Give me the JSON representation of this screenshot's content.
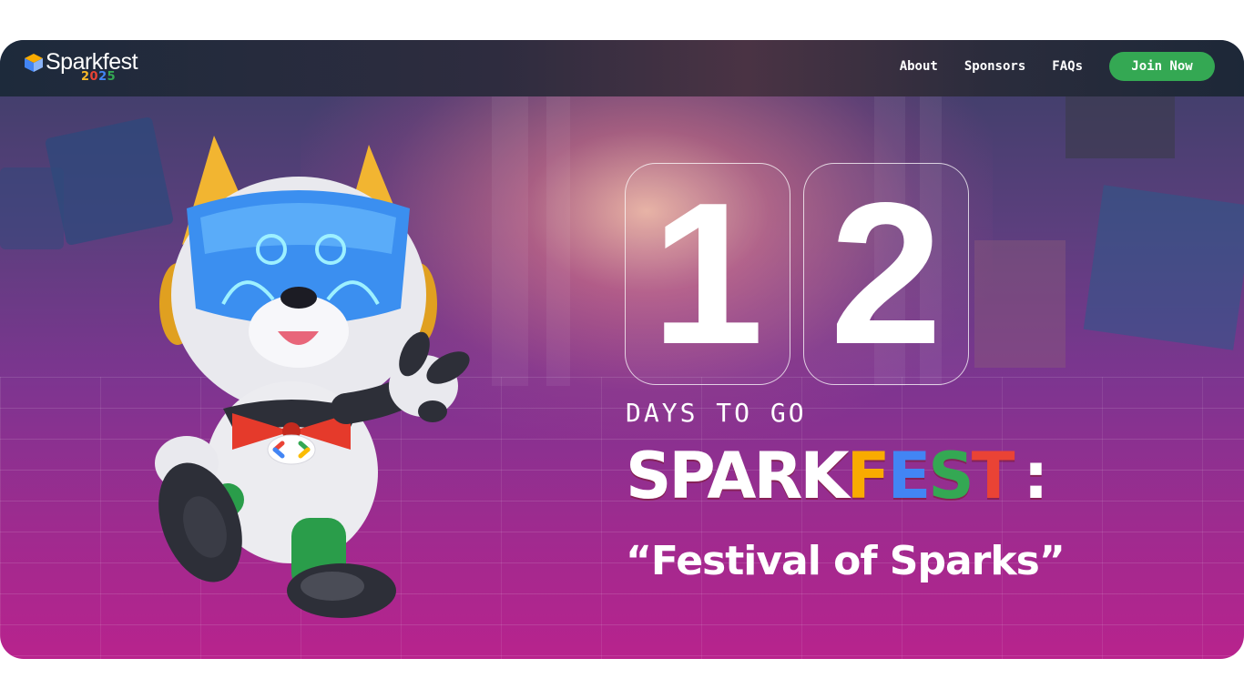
{
  "brand": {
    "name": "Sparkfest",
    "year_digits": [
      "2",
      "0",
      "2",
      "5"
    ]
  },
  "nav": {
    "links": [
      "About",
      "Sponsors",
      "FAQs"
    ],
    "cta_label": "Join Now"
  },
  "countdown": {
    "digits": [
      "1",
      "2"
    ],
    "caption": "DAYS TO GO"
  },
  "headline": {
    "part_white": "SPARK",
    "part_colored": [
      "F",
      "E",
      "S",
      "T"
    ],
    "suffix": ":"
  },
  "tagline": "“Festival of Sparks”",
  "colors": {
    "accent_green": "#34a853",
    "google_yellow": "#f9ab00",
    "google_blue": "#4285f4",
    "google_red": "#ea4335"
  },
  "icons": {
    "logo": "sparkfest-cube-logo",
    "mascot": "robot-dog-mascot"
  }
}
